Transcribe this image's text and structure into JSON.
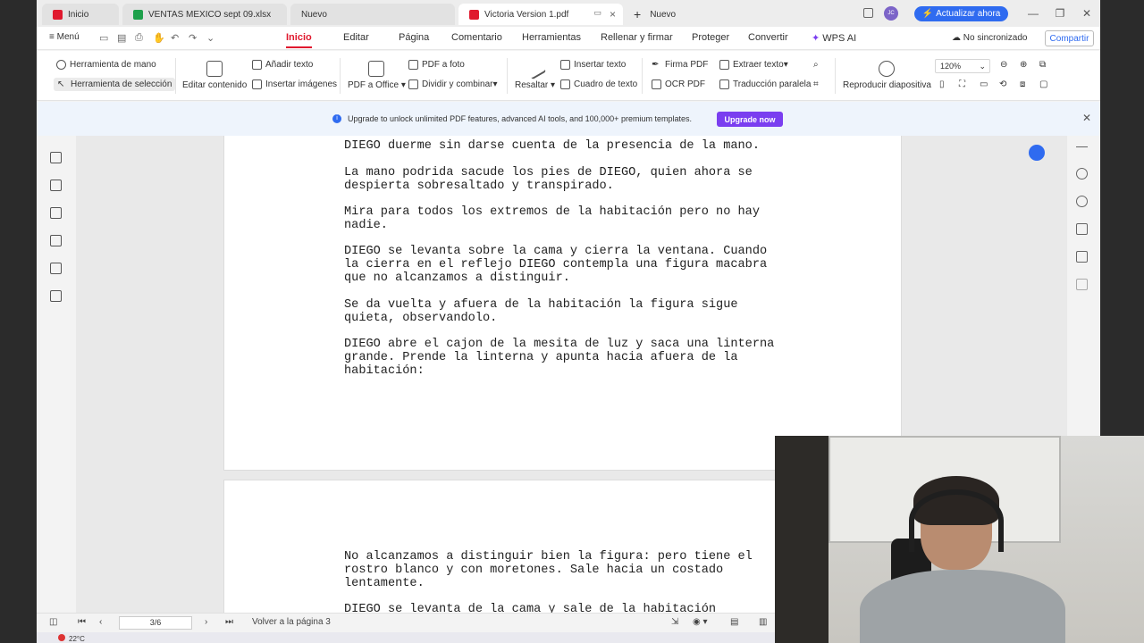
{
  "tabs": {
    "items": [
      {
        "label": "Inicio"
      },
      {
        "label": "VENTAS MEXICO sept 09.xlsx"
      },
      {
        "label": "Nuevo"
      },
      {
        "label": "Victoria Version 1.pdf"
      }
    ],
    "new_tab": "Nuevo",
    "upgrade": "Actualizar ahora",
    "avatar_initials": "JC"
  },
  "menu": {
    "menu_label": "Menú",
    "tabs": [
      "Inicio",
      "Editar",
      "Página",
      "Comentario",
      "Herramientas",
      "Rellenar y firmar",
      "Proteger",
      "Convertir",
      "WPS AI"
    ],
    "active_tab": "Inicio",
    "sync": "No sincronizado",
    "share": "Compartir"
  },
  "ribbon": {
    "hand_tool": "Herramienta de mano",
    "select_tool": "Herramienta de selección",
    "edit_content": "Editar contenido",
    "add_text": "Añadir texto",
    "insert_images": "Insertar imágenes",
    "pdf_to_office": "PDF a Office",
    "pdf_to_photo": "PDF a foto",
    "split_merge": "Dividir y combinar",
    "highlight": "Resaltar",
    "insert_text": "Insertar texto",
    "text_box": "Cuadro de texto",
    "pdf_signature": "Firma PDF",
    "ocr_pdf": "OCR PDF",
    "extract_text": "Extraer texto",
    "parallel_translation": "Traducción paralela",
    "play_slideshow": "Reproducir diapositiva",
    "zoom": "120%"
  },
  "banner": {
    "text": "Upgrade to unlock unlimited PDF features, advanced AI tools, and 100,000+ premium templates.",
    "button": "Upgrade now"
  },
  "document": {
    "page1_paragraphs": [
      "DIEGO duerme sin darse cuenta de la presencia de la mano.",
      "La mano podrida sacude los pies de DIEGO, quien ahora se\ndespierta sobresaltado y transpirado.",
      "Mira para todos los extremos de la habitación pero no hay\nnadie.",
      "DIEGO se levanta sobre la cama y cierra la ventana. Cuando\nla cierra en el reflejo DIEGO contempla una figura macabra\nque no alcanzamos a distinguir.",
      "Se da vuelta y afuera de la habitación la figura sigue\nquieta, observandolo.",
      "DIEGO abre el cajon de la mesita de luz y saca una linterna\ngrande. Prende la linterna y apunta hacia afuera de la\nhabitación:"
    ],
    "page2_paragraphs": [
      "No alcanzamos a distinguir bien la figura: pero tiene el\nrostro blanco y con moretones. Sale hacia un costado\nlentamente.",
      "DIEGO se levanta de la cama y sale de la habitación"
    ]
  },
  "status": {
    "page_indicator": "3/6",
    "back_to_page": "Volver a la página 3"
  },
  "taskbar": {
    "weather": "22°C"
  }
}
